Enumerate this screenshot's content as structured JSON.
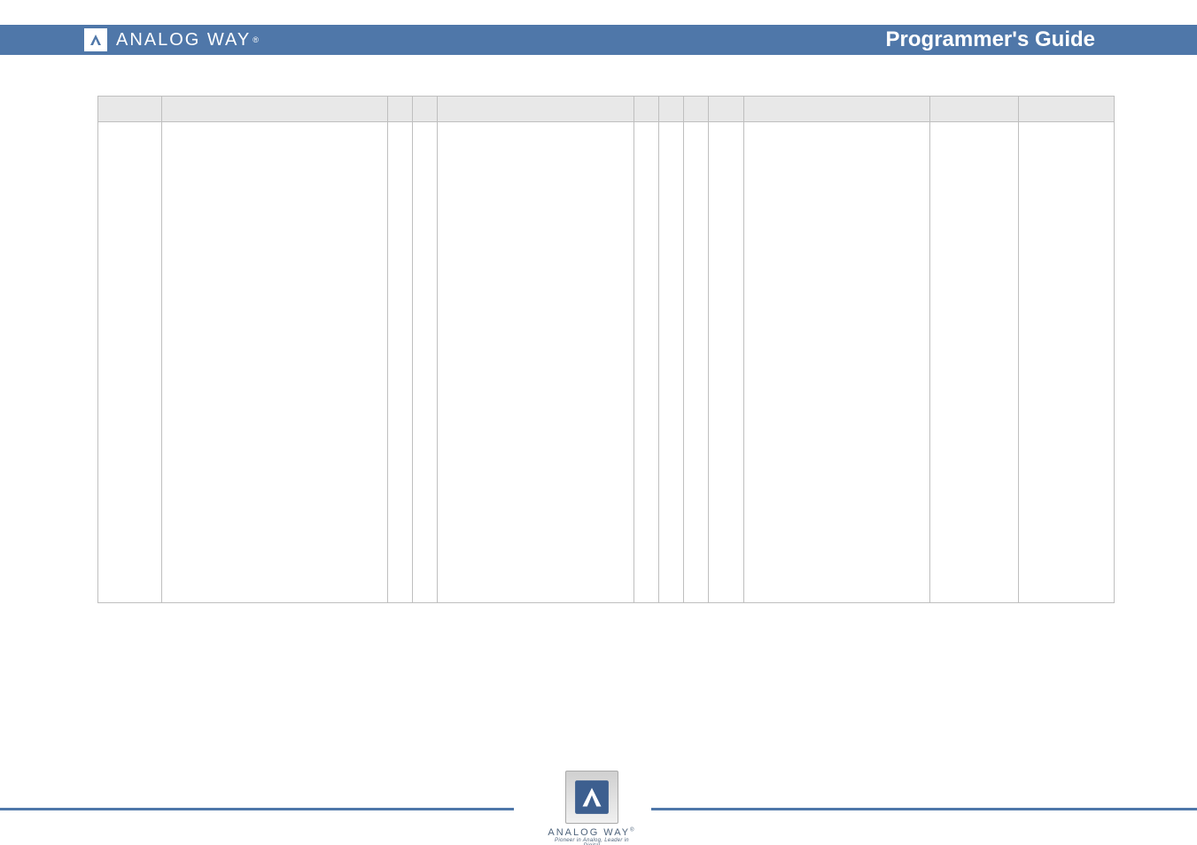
{
  "brand": {
    "name": "ANALOG WAY",
    "registered_mark": "®",
    "tagline": "Pioneer in Analog, Leader in Digital"
  },
  "header": {
    "title": "Programmer's Guide"
  },
  "colors": {
    "header_bar": "#4f77a9",
    "table_header_bg": "#e8e8e8",
    "table_border": "#bfbfbf"
  },
  "table": {
    "headers": [
      "",
      "",
      "",
      "",
      "",
      "",
      "",
      "",
      "",
      "",
      "",
      ""
    ],
    "rows": [
      [
        "",
        "",
        "",
        "",
        "",
        "",
        "",
        "",
        "",
        "",
        "",
        ""
      ]
    ]
  }
}
